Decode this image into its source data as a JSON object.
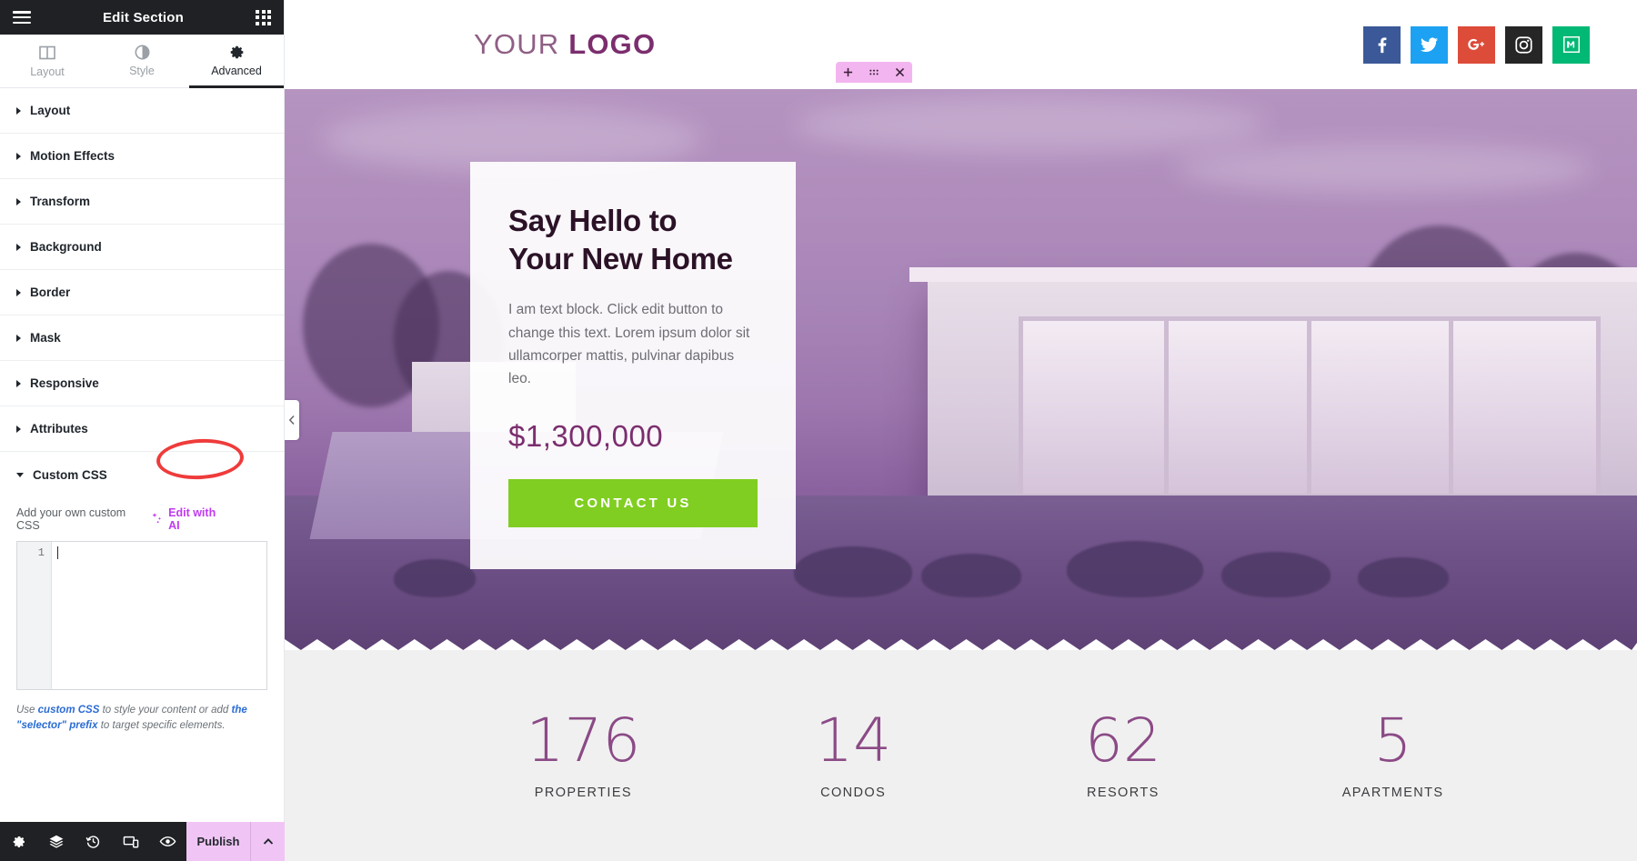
{
  "panel": {
    "header": {
      "title": "Edit Section",
      "menu_icon": "hamburger-icon",
      "apps_icon": "grid-apps-icon"
    },
    "tabs": [
      {
        "label": "Layout",
        "icon": "columns-icon",
        "active": false
      },
      {
        "label": "Style",
        "icon": "contrast-circle-icon",
        "active": false
      },
      {
        "label": "Advanced",
        "icon": "gear-icon",
        "active": true
      }
    ],
    "sections": [
      {
        "label": "Layout",
        "expanded": false
      },
      {
        "label": "Motion Effects",
        "expanded": false
      },
      {
        "label": "Transform",
        "expanded": false
      },
      {
        "label": "Background",
        "expanded": false
      },
      {
        "label": "Border",
        "expanded": false
      },
      {
        "label": "Mask",
        "expanded": false
      },
      {
        "label": "Responsive",
        "expanded": false
      },
      {
        "label": "Attributes",
        "expanded": false
      },
      {
        "label": "Custom CSS",
        "expanded": true
      }
    ],
    "custom_css": {
      "field_label": "Add your own custom CSS",
      "edit_with_ai_label": "Edit with AI",
      "edit_with_ai_icon": "ai-sparkle-icon",
      "line_number": "1",
      "editor_value": "",
      "hint_1": "Use ",
      "hint_link_1": "custom CSS",
      "hint_2": " to style your content or add ",
      "hint_link_2": "the \"selector\" prefix",
      "hint_3": " to target specific elements."
    },
    "footer": {
      "icons": [
        {
          "name": "settings-gear-icon"
        },
        {
          "name": "navigator-layers-icon"
        },
        {
          "name": "history-revisions-icon"
        },
        {
          "name": "responsive-mode-icon"
        },
        {
          "name": "preview-eye-icon"
        }
      ],
      "publish_label": "Publish",
      "publish_caret_icon": "chevron-up-icon"
    }
  },
  "canvas": {
    "section_handle": {
      "add_icon": "plus-icon",
      "drag_icon": "drag-dots-icon",
      "close_icon": "close-x-icon"
    },
    "collapse_icon": "chevron-left-icon",
    "header": {
      "logo_light": "YOUR",
      "logo_bold": "LOGO",
      "socials": [
        {
          "name": "facebook-icon",
          "glyph": "f",
          "color": "#3b5998"
        },
        {
          "name": "twitter-icon",
          "glyph": "t",
          "color": "#1da1f2"
        },
        {
          "name": "google-plus-icon",
          "glyph": "G+",
          "color": "#dd4b39"
        },
        {
          "name": "instagram-icon",
          "glyph": "ig",
          "color": "#262626"
        },
        {
          "name": "medium-icon",
          "glyph": "M",
          "color": "#02b875"
        }
      ]
    },
    "hero": {
      "heading_line_1": "Say Hello to",
      "heading_line_2": "Your New Home",
      "paragraph": "I am text block. Click edit button to change this text. Lorem ipsum dolor sit ullamcorper mattis, pulvinar dapibus leo.",
      "price": "$1,300,000",
      "cta_label": "CONTACT US",
      "cta_color": "#80ce21"
    },
    "stats": [
      {
        "number": "176",
        "label": "PROPERTIES"
      },
      {
        "number": "14",
        "label": "CONDOS"
      },
      {
        "number": "62",
        "label": "RESORTS"
      },
      {
        "number": "5",
        "label": "APARTMENTS"
      }
    ]
  }
}
